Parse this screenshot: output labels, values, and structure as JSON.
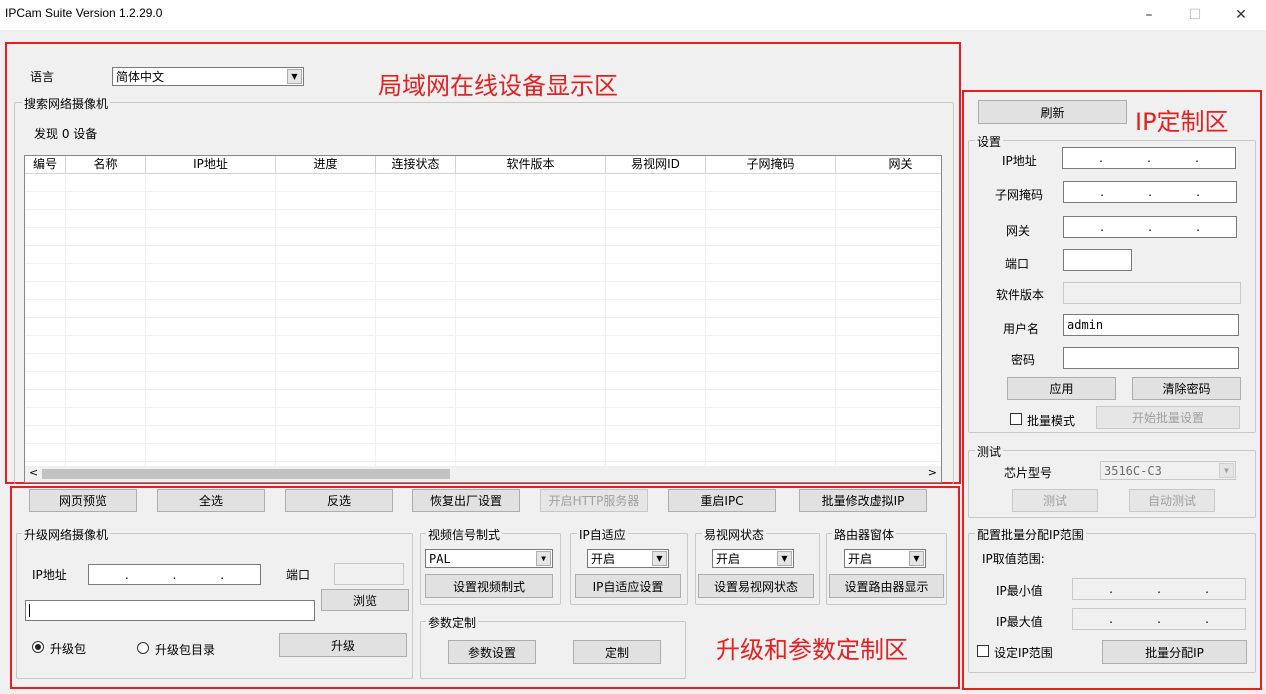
{
  "window": {
    "title": "IPCam Suite Version 1.2.29.0",
    "minimize_glyph": "–",
    "maximize_glyph": "☐",
    "close_glyph": "✕"
  },
  "annotations": {
    "lan_area": "局域网在线设备显示区",
    "ip_area": "IP定制区",
    "upgrade_area": "升级和参数定制区"
  },
  "language": {
    "label": "语言",
    "value": "简体中文"
  },
  "search_group": {
    "title": "搜索网络摄像机",
    "found_text": "发现 0 设备"
  },
  "table": {
    "columns": [
      "编号",
      "名称",
      "IP地址",
      "进度",
      "连接状态",
      "软件版本",
      "易视网ID",
      "子网掩码",
      "网关"
    ],
    "scroll_left": "<",
    "scroll_right": ">"
  },
  "action_buttons": [
    "网页预览",
    "全选",
    "反选",
    "恢复出厂设置",
    "开启HTTP服务器",
    "重启IPC",
    "批量修改虚拟IP"
  ],
  "upgrade": {
    "title": "升级网络摄像机",
    "ip_label": "IP地址",
    "port_label": "端口",
    "browse_button": "浏览",
    "radio_package": "升级包",
    "radio_dir": "升级包目录",
    "upgrade_button": "升级"
  },
  "video": {
    "title": "视频信号制式",
    "value": "PAL",
    "button": "设置视频制式"
  },
  "ip_adapt": {
    "title": "IP自适应",
    "value": "开启",
    "button": "IP自适应设置"
  },
  "esee": {
    "title": "易视网状态",
    "value": "开启",
    "button": "设置易视网状态"
  },
  "router": {
    "title": "路由器窗体",
    "value": "开启",
    "button": "设置路由器显示"
  },
  "params": {
    "title": "参数定制",
    "settings_button": "参数设置",
    "custom_button": "定制"
  },
  "right": {
    "refresh_button": "刷新",
    "settings": {
      "title": "设置",
      "ip_label": "IP地址",
      "mask_label": "子网掩码",
      "gateway_label": "网关",
      "port_label": "端口",
      "version_label": "软件版本",
      "user_label": "用户名",
      "user_value": "admin",
      "password_label": "密码",
      "apply_button": "应用",
      "clear_password_button": "清除密码",
      "batch_mode_label": "批量模式",
      "start_batch_button": "开始批量设置"
    },
    "test": {
      "title": "测试",
      "chip_label": "芯片型号",
      "chip_value": "3516C-C3",
      "test_button": "测试",
      "auto_test_button": "自动测试"
    },
    "batch_ip": {
      "title": "配置批量分配IP范围",
      "range_label": "IP取值范围:",
      "min_label": "IP最小值",
      "max_label": "IP最大值",
      "set_range_label": "设定IP范围",
      "assign_button": "批量分配IP"
    }
  },
  "ip_dot": "."
}
